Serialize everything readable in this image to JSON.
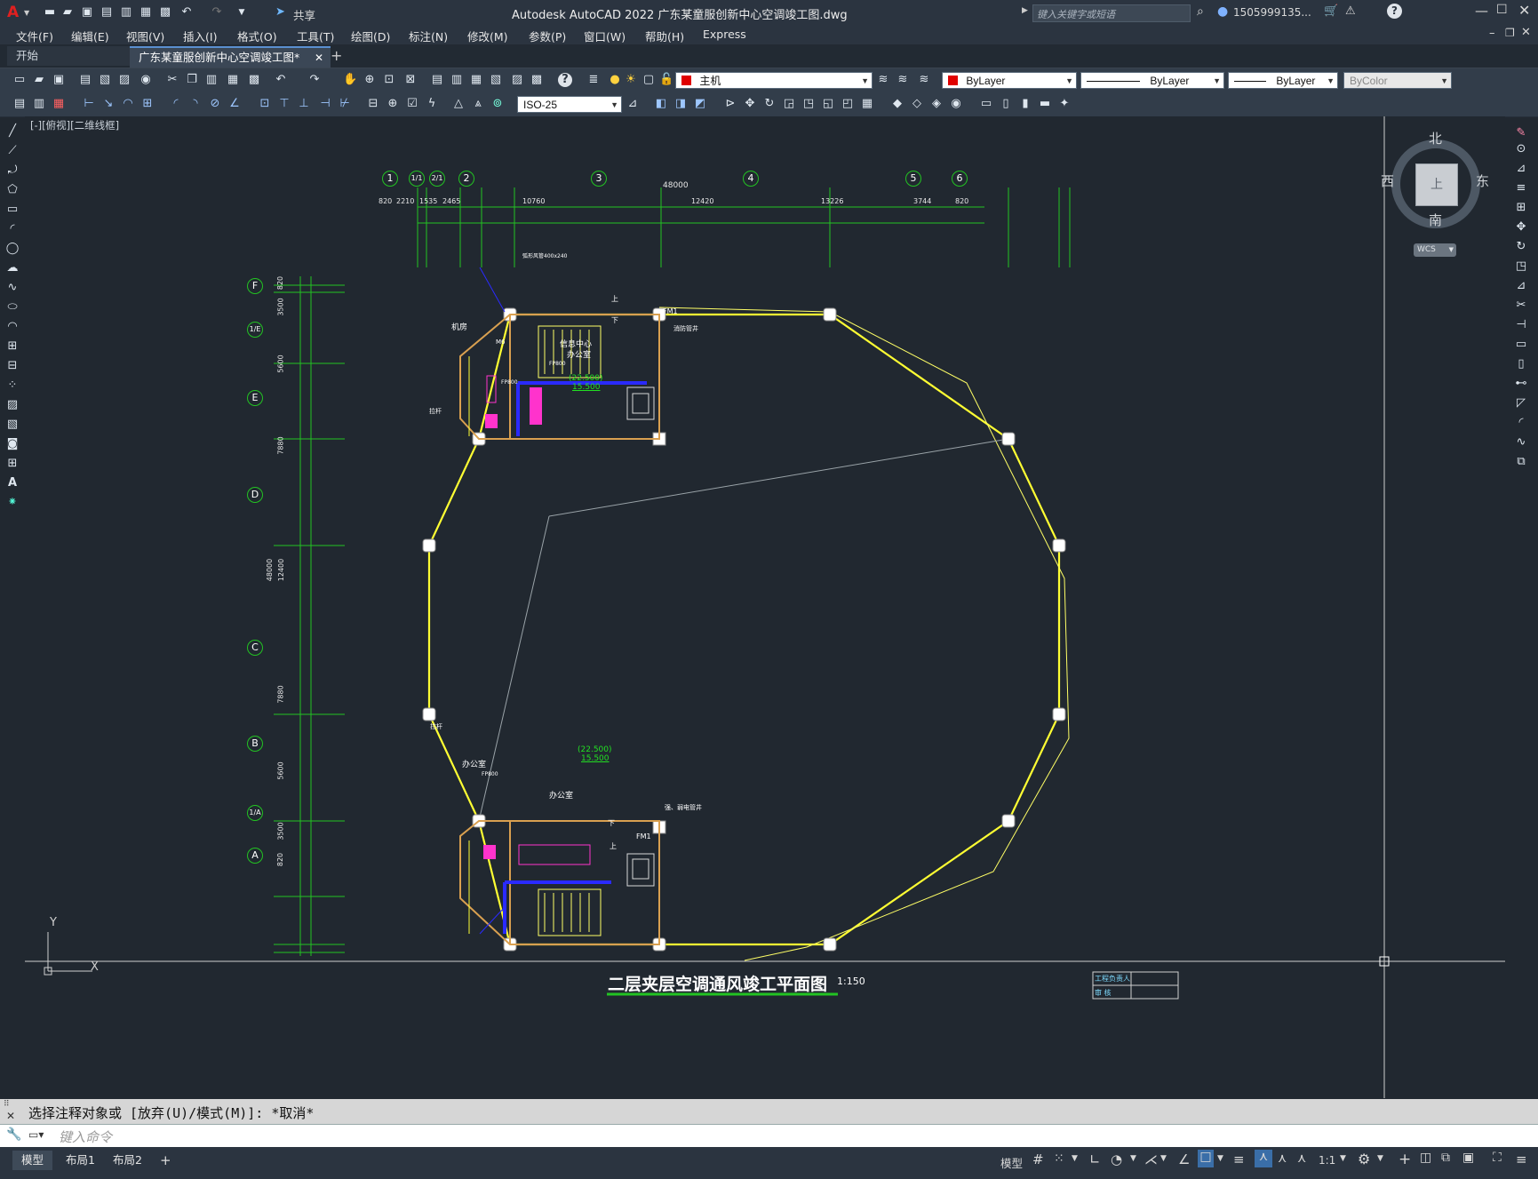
{
  "titlebar": {
    "app_letter": "A",
    "share_label": "共享",
    "title": "Autodesk AutoCAD 2022    广东某童服创新中心空调竣工图.dwg",
    "search_placeholder": "键入关键字或短语",
    "user": "1505999135...",
    "help": "?"
  },
  "menu": [
    "文件(F)",
    "编辑(E)",
    "视图(V)",
    "插入(I)",
    "格式(O)",
    "工具(T)",
    "绘图(D)",
    "标注(N)",
    "修改(M)",
    "参数(P)",
    "窗口(W)",
    "帮助(H)",
    "Express"
  ],
  "tabs": {
    "start": "开始",
    "drawing": "广东某童服创新中心空调竣工图*",
    "add": "+"
  },
  "toolbar": {
    "layer": "主机",
    "color": "ByLayer",
    "linetype": "ByLayer",
    "lineweight": "ByLayer",
    "plotstyle": "ByColor",
    "dimstyle": "ISO-25",
    "accent_red": "#e00000"
  },
  "viewport": {
    "label": "[-][俯视][二维线框]",
    "viewcube": {
      "north": "北",
      "south": "南",
      "east": "东",
      "west": "西",
      "top": "上",
      "wcs": "WCS"
    },
    "ucs_x": "X",
    "ucs_y": "Y"
  },
  "drawing": {
    "grid_h": [
      "1",
      "1/1",
      "2/1",
      "2",
      "3",
      "4",
      "5",
      "6"
    ],
    "grid_v": [
      "F",
      "1/E",
      "E",
      "D",
      "C",
      "B",
      "1/A",
      "A"
    ],
    "dims_top": [
      "820",
      "2210",
      "1535",
      "2465",
      "10760",
      "12420",
      "13226",
      "3744",
      "820"
    ],
    "dim_total_top": "48000",
    "dims_left": [
      "820",
      "3500",
      "5600",
      "7880",
      "12400",
      "7880",
      "5600",
      "3500",
      "820"
    ],
    "dim_total_left": "48000",
    "room_upper": [
      "信息中心",
      "办公室",
      "机房",
      "(22.500)",
      "15.500",
      "FM1",
      "消防管井",
      "上",
      "下",
      "M6",
      "FP800",
      "FP800",
      "弧形风管400x240",
      "拉杆"
    ],
    "room_lower": [
      "办公室",
      "办公室",
      "(22.500)",
      "15.500",
      "FM1",
      "强、弱电管井",
      "上",
      "下",
      "FP800",
      "拉杆"
    ],
    "title": "二层夹层空调通风竣工平面图",
    "scale": "1:150",
    "tb_label1": "工程负责人",
    "tb_label2": "审 核"
  },
  "command": {
    "history": "选择注释对象或 [放弃(U)/模式(M)]: *取消*",
    "placeholder": "键入命令"
  },
  "status": {
    "tabs": [
      "模型",
      "布局1",
      "布局2"
    ],
    "model_label": "模型",
    "scale": "1:1"
  }
}
